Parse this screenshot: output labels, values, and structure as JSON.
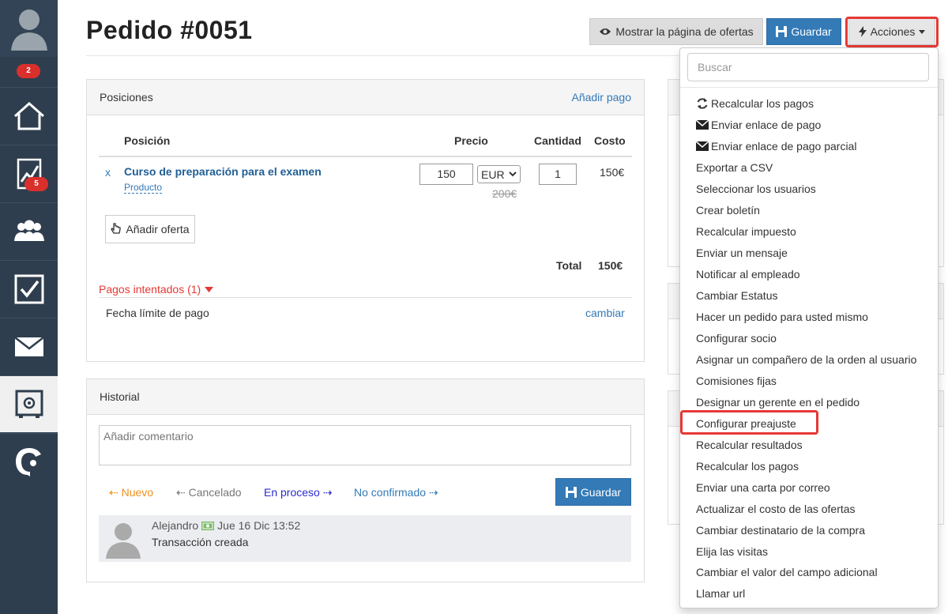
{
  "sidebar": {
    "badge_top": "2",
    "badge_chart": "5"
  },
  "header": {
    "title": "Pedido #0051",
    "show_offers_label": "Mostrar la página de ofertas",
    "save_label": "Guardar",
    "actions_label": "Acciones"
  },
  "positions": {
    "title": "Posiciones",
    "add_payment": "Añadir pago",
    "col_position": "Posición",
    "col_price": "Precio",
    "col_quantity": "Cantidad",
    "col_cost": "Costo",
    "remove": "x",
    "item_name": "Curso de preparación para el examen",
    "item_type": "Producto",
    "price": "150",
    "currency": "EUR",
    "old_price": "200€",
    "quantity": "1",
    "cost": "150€",
    "add_offer": "Añadir oferta",
    "total_label": "Total",
    "total_value": "150€",
    "attempted_payments": "Pagos intentados (1)",
    "due_date_label": "Fecha límite de pago",
    "change": "cambiar"
  },
  "history": {
    "title": "Historial",
    "comment_placeholder": "Añadir comentario",
    "status_new": "Nuevo",
    "status_cancelled": "Cancelado",
    "status_in_process": "En proceso",
    "status_unconfirmed": "No confirmado",
    "save_label": "Guardar",
    "entry_author": "Alejandro",
    "entry_date": "Jue 16 Dic 13:52",
    "entry_text": "Transacción creada"
  },
  "actions_menu": {
    "search_placeholder": "Buscar",
    "items": [
      "Recalcular los pagos",
      "Enviar enlace de pago",
      "Enviar enlace de pago parcial",
      "Exportar a CSV",
      "Seleccionar los usuarios",
      "Crear boletín",
      "Recalcular impuesto",
      "Enviar un mensaje",
      "Notificar al empleado",
      "Cambiar Estatus",
      "Hacer un pedido para usted mismo",
      "Configurar socio",
      "Asignar un compañero de la orden al usuario",
      "Comisiones fijas",
      "Designar un gerente en el pedido",
      "Configurar preajuste",
      "Recalcular resultados",
      "Recalcular los pagos",
      "Enviar una carta por correo",
      "Actualizar el costo de las ofertas",
      "Cambiar destinatario de la compra",
      "Elija las visitas",
      "Cambiar el valor del campo adicional",
      "Llamar url"
    ]
  },
  "colors": {
    "sidebar_bg": "#2f3e4e",
    "primary": "#337ab7",
    "highlight": "#e53935",
    "badge": "#d9302c"
  }
}
